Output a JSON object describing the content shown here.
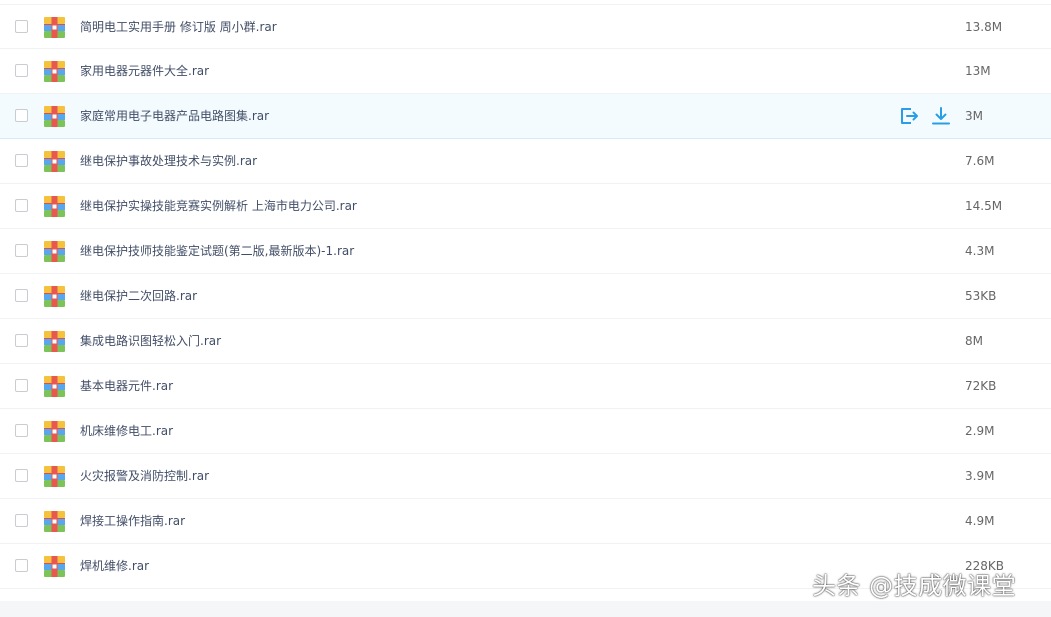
{
  "colors": {
    "accent": "#2a9de8",
    "hover_row": "#f4fbff",
    "text": "#424e67",
    "size_text": "#666666"
  },
  "row_actions": {
    "share_icon": "share-icon",
    "download_icon": "download-icon"
  },
  "files": [
    {
      "name": "简明电工实用手册 修订版 周小群.rar",
      "size": "13.8M",
      "icon": "rar-archive-icon"
    },
    {
      "name": "家用电器元器件大全.rar",
      "size": "13M",
      "icon": "rar-archive-icon"
    },
    {
      "name": "家庭常用电子电器产品电路图集.rar",
      "size": "3M",
      "icon": "rar-archive-icon",
      "hovered": true
    },
    {
      "name": "继电保护事故处理技术与实例.rar",
      "size": "7.6M",
      "icon": "rar-archive-icon"
    },
    {
      "name": "继电保护实操技能竞赛实例解析 上海市电力公司.rar",
      "size": "14.5M",
      "icon": "rar-archive-icon"
    },
    {
      "name": "继电保护技师技能鉴定试题(第二版,最新版本)-1.rar",
      "size": "4.3M",
      "icon": "rar-archive-icon"
    },
    {
      "name": "继电保护二次回路.rar",
      "size": "53KB",
      "icon": "rar-archive-icon"
    },
    {
      "name": "集成电路识图轻松入门.rar",
      "size": "8M",
      "icon": "rar-archive-icon"
    },
    {
      "name": "基本电器元件.rar",
      "size": "72KB",
      "icon": "rar-archive-icon"
    },
    {
      "name": "机床维修电工.rar",
      "size": "2.9M",
      "icon": "rar-archive-icon"
    },
    {
      "name": "火灾报警及消防控制.rar",
      "size": "3.9M",
      "icon": "rar-archive-icon"
    },
    {
      "name": "焊接工操作指南.rar",
      "size": "4.9M",
      "icon": "rar-archive-icon"
    },
    {
      "name": "焊机维修.rar",
      "size": "228KB",
      "icon": "rar-archive-icon"
    }
  ],
  "watermark": "头条 @技成微课堂"
}
